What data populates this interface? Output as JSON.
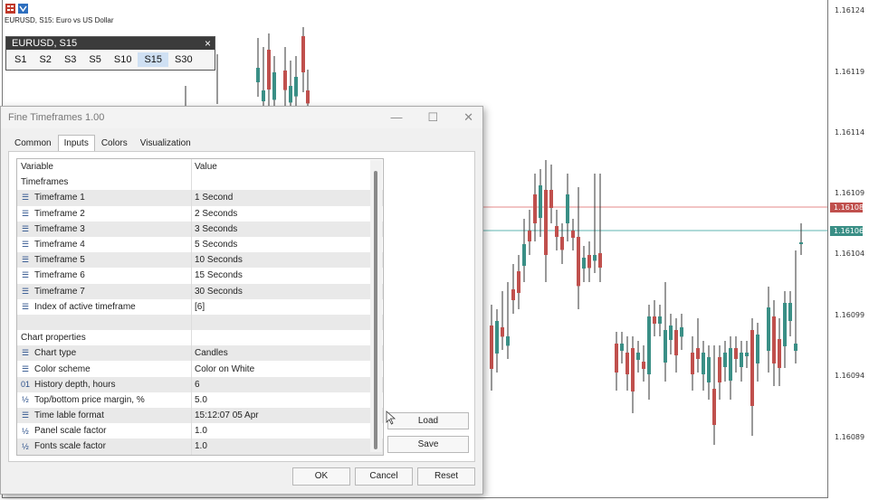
{
  "chart": {
    "title": "EURUSD, S15: Euro vs US Dollar",
    "price_labels": [
      "1.16124",
      "1.16119",
      "1.16114",
      "1.16109",
      "1.16104",
      "1.16099",
      "1.16094",
      "1.16089"
    ],
    "ask_tag": "1.16108",
    "bid_tag": "1.16106",
    "colors": {
      "up": "#3a8f86",
      "down": "#c0504d",
      "ask": "#e58a8a",
      "bid": "#5fb5b0"
    }
  },
  "tf_panel": {
    "title": "EURUSD, S15",
    "close": "×",
    "buttons": [
      "S1",
      "S2",
      "S3",
      "S5",
      "S10",
      "S15",
      "S30"
    ],
    "active": "S15"
  },
  "dialog": {
    "title": "Fine Timeframes 1.00",
    "controls": {
      "minimize": "—",
      "maximize": "☐",
      "close": "✕"
    },
    "tabs": [
      "Common",
      "Inputs",
      "Colors",
      "Visualization"
    ],
    "active_tab": "Inputs",
    "grid": {
      "col_variable": "Variable",
      "col_value": "Value",
      "sections": {
        "timeframes": "Timeframes",
        "chart_properties": "Chart properties"
      },
      "timeframe_rows": [
        {
          "icon": "enum-icon",
          "name": "Timeframe 1",
          "value": "1 Second"
        },
        {
          "icon": "enum-icon",
          "name": "Timeframe 2",
          "value": "2 Seconds"
        },
        {
          "icon": "enum-icon",
          "name": "Timeframe 3",
          "value": "3 Seconds"
        },
        {
          "icon": "enum-icon",
          "name": "Timeframe 4",
          "value": "5 Seconds"
        },
        {
          "icon": "enum-icon",
          "name": "Timeframe 5",
          "value": "10 Seconds"
        },
        {
          "icon": "enum-icon",
          "name": "Timeframe 6",
          "value": "15 Seconds"
        },
        {
          "icon": "enum-icon",
          "name": "Timeframe 7",
          "value": "30 Seconds"
        },
        {
          "icon": "enum-icon",
          "name": "Index of active timeframe",
          "value": "[6]"
        }
      ],
      "property_rows": [
        {
          "icon": "enum-icon",
          "glyph": "☰",
          "name": "Chart type",
          "value": "Candles"
        },
        {
          "icon": "enum-icon",
          "glyph": "☰",
          "name": "Color scheme",
          "value": "Color on White"
        },
        {
          "icon": "integer-icon",
          "glyph": "01",
          "name": "History depth, hours",
          "value": "6"
        },
        {
          "icon": "double-icon",
          "glyph": "½",
          "name": "Top/bottom price margin, %",
          "value": "5.0"
        },
        {
          "icon": "enum-icon",
          "glyph": "☰",
          "name": "Time lable format",
          "value": "15:12:07 05 Apr"
        },
        {
          "icon": "double-icon",
          "glyph": "½",
          "name": "Panel scale factor",
          "value": "1.0"
        },
        {
          "icon": "double-icon",
          "glyph": "½",
          "name": "Fonts scale factor",
          "value": "1.0"
        }
      ]
    },
    "buttons": {
      "load": "Load",
      "save": "Save",
      "ok": "OK",
      "cancel": "Cancel",
      "reset": "Reset"
    }
  }
}
